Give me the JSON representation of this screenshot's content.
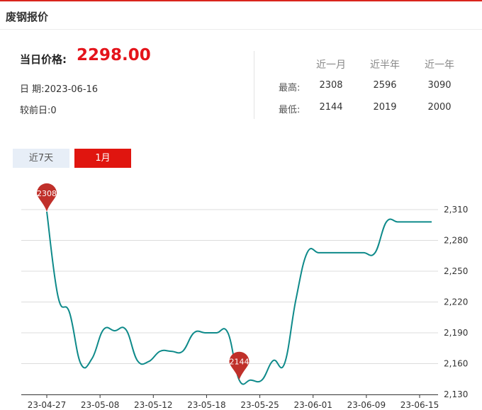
{
  "header": {
    "title": "废钢报价"
  },
  "summary": {
    "price_label": "当日价格:",
    "price_value": "2298.00",
    "date_label": "日 期:",
    "date_value": "2023-06-16",
    "change_label": "较前日:",
    "change_value": "0"
  },
  "stats": {
    "columns": [
      "近一月",
      "近半年",
      "近一年"
    ],
    "rows": [
      {
        "label": "最高:",
        "values": [
          "2308",
          "2596",
          "3090"
        ]
      },
      {
        "label": "最低:",
        "values": [
          "2144",
          "2019",
          "2000"
        ]
      }
    ]
  },
  "tabs": [
    {
      "label": "近7天",
      "active": false
    },
    {
      "label": "1月",
      "active": true
    }
  ],
  "colors": {
    "accent": "#e0150f",
    "line": "#0e8a8a",
    "pin": "#c0302a",
    "tab_inactive": "#e7eef7"
  },
  "chart_data": {
    "type": "line",
    "x_tick_labels": [
      "23-04-27",
      "23-05-08",
      "23-05-12",
      "23-05-18",
      "23-05-25",
      "23-06-01",
      "23-06-09",
      "23-06-15"
    ],
    "y_tick_labels": [
      "2,130",
      "2,160",
      "2,190",
      "2,220",
      "2,250",
      "2,280",
      "2,310"
    ],
    "ylim": [
      2130,
      2310
    ],
    "grid": true,
    "legend": "none",
    "y_axis_position": "right",
    "series": [
      {
        "x": [
          "04-27",
          "04-28",
          "05-04",
          "05-05",
          "05-06",
          "05-08",
          "05-09",
          "05-10",
          "05-11",
          "05-12",
          "05-15",
          "05-16",
          "05-17",
          "05-18",
          "05-19",
          "05-22",
          "05-23",
          "05-24",
          "05-25",
          "05-26",
          "05-29",
          "05-30",
          "05-31",
          "06-01",
          "06-02",
          "06-05",
          "06-06",
          "06-07",
          "06-08",
          "06-09",
          "06-12",
          "06-13",
          "06-14",
          "06-15",
          "06-16"
        ],
        "values": [
          2308,
          2225,
          2210,
          2160,
          2165,
          2193,
          2192,
          2193,
          2163,
          2162,
          2172,
          2172,
          2172,
          2190,
          2190,
          2190,
          2190,
          2144,
          2144,
          2144,
          2163,
          2160,
          2222,
          2268,
          2268,
          2268,
          2268,
          2268,
          2268,
          2268,
          2298,
          2298,
          2298,
          2298,
          2298
        ]
      }
    ],
    "markers": [
      {
        "label": "2308",
        "value": 2308
      },
      {
        "label": "2144",
        "value": 2144
      }
    ]
  }
}
